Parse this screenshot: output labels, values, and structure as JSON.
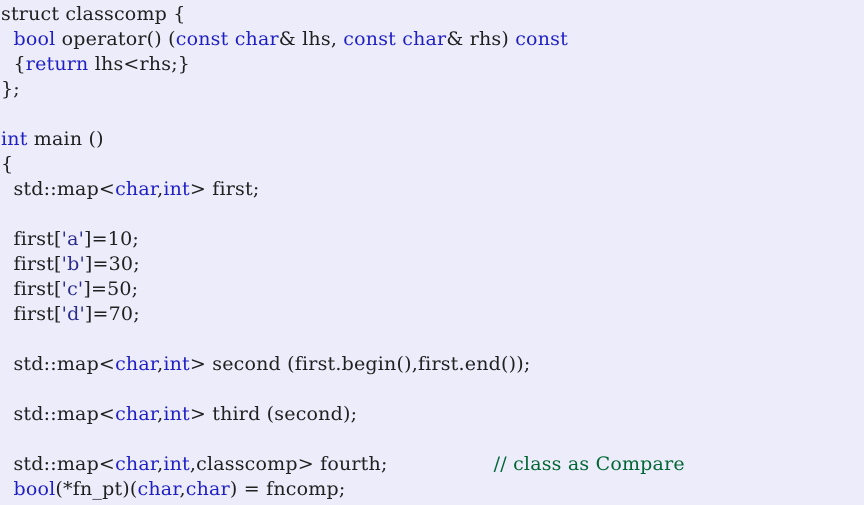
{
  "editor": {
    "background_color": "#ececfb",
    "default_text_color": "#202020",
    "keyword_color": "#1f1fc4",
    "comment_color": "#006633",
    "literal_color": "#2b2b8f",
    "language": "C++"
  },
  "code": {
    "lines": [
      {
        "index": 1,
        "text": "struct classcomp {",
        "tokens": [
          {
            "t": "struct classcomp {",
            "c": "plain"
          }
        ]
      },
      {
        "index": 2,
        "text": "  bool operator() (const char& lhs, const char& rhs) const",
        "tokens": [
          {
            "t": "  ",
            "c": "plain"
          },
          {
            "t": "bool",
            "c": "kw"
          },
          {
            "t": " operator() (",
            "c": "plain"
          },
          {
            "t": "const",
            "c": "kw"
          },
          {
            "t": " ",
            "c": "plain"
          },
          {
            "t": "char",
            "c": "kw"
          },
          {
            "t": "& lhs, ",
            "c": "plain"
          },
          {
            "t": "const",
            "c": "kw"
          },
          {
            "t": " ",
            "c": "plain"
          },
          {
            "t": "char",
            "c": "kw"
          },
          {
            "t": "& rhs) ",
            "c": "plain"
          },
          {
            "t": "const",
            "c": "kw"
          }
        ]
      },
      {
        "index": 3,
        "text": "  {return lhs<rhs;}",
        "tokens": [
          {
            "t": "  {",
            "c": "plain"
          },
          {
            "t": "return",
            "c": "kw"
          },
          {
            "t": " lhs<rhs;}",
            "c": "plain"
          }
        ]
      },
      {
        "index": 4,
        "text": "};",
        "tokens": [
          {
            "t": "};",
            "c": "plain"
          }
        ]
      },
      {
        "index": 5,
        "text": "",
        "tokens": []
      },
      {
        "index": 6,
        "text": "int main ()",
        "tokens": [
          {
            "t": "int",
            "c": "kw"
          },
          {
            "t": " main ()",
            "c": "plain"
          }
        ]
      },
      {
        "index": 7,
        "text": "{",
        "tokens": [
          {
            "t": "{",
            "c": "plain"
          }
        ]
      },
      {
        "index": 8,
        "text": "  std::map<char,int> first;",
        "tokens": [
          {
            "t": "  std::map<",
            "c": "plain"
          },
          {
            "t": "char",
            "c": "kw"
          },
          {
            "t": ",",
            "c": "plain"
          },
          {
            "t": "int",
            "c": "kw"
          },
          {
            "t": "> first;",
            "c": "plain"
          }
        ]
      },
      {
        "index": 9,
        "text": "",
        "tokens": []
      },
      {
        "index": 10,
        "text": "  first['a']=10;",
        "tokens": [
          {
            "t": "  first[",
            "c": "plain"
          },
          {
            "t": "'a'",
            "c": "lit"
          },
          {
            "t": "]=10;",
            "c": "plain"
          }
        ]
      },
      {
        "index": 11,
        "text": "  first['b']=30;",
        "tokens": [
          {
            "t": "  first[",
            "c": "plain"
          },
          {
            "t": "'b'",
            "c": "lit"
          },
          {
            "t": "]=30;",
            "c": "plain"
          }
        ]
      },
      {
        "index": 12,
        "text": "  first['c']=50;",
        "tokens": [
          {
            "t": "  first[",
            "c": "plain"
          },
          {
            "t": "'c'",
            "c": "lit"
          },
          {
            "t": "]=50;",
            "c": "plain"
          }
        ]
      },
      {
        "index": 13,
        "text": "  first['d']=70;",
        "tokens": [
          {
            "t": "  first[",
            "c": "plain"
          },
          {
            "t": "'d'",
            "c": "lit"
          },
          {
            "t": "]=70;",
            "c": "plain"
          }
        ]
      },
      {
        "index": 14,
        "text": "",
        "tokens": []
      },
      {
        "index": 15,
        "text": "  std::map<char,int> second (first.begin(),first.end());",
        "tokens": [
          {
            "t": "  std::map<",
            "c": "plain"
          },
          {
            "t": "char",
            "c": "kw"
          },
          {
            "t": ",",
            "c": "plain"
          },
          {
            "t": "int",
            "c": "kw"
          },
          {
            "t": "> second (first.begin(),first.end());",
            "c": "plain"
          }
        ]
      },
      {
        "index": 16,
        "text": "",
        "tokens": []
      },
      {
        "index": 17,
        "text": "  std::map<char,int> third (second);",
        "tokens": [
          {
            "t": "  std::map<",
            "c": "plain"
          },
          {
            "t": "char",
            "c": "kw"
          },
          {
            "t": ",",
            "c": "plain"
          },
          {
            "t": "int",
            "c": "kw"
          },
          {
            "t": "> third (second);",
            "c": "plain"
          }
        ]
      },
      {
        "index": 18,
        "text": "",
        "tokens": []
      },
      {
        "index": 19,
        "text": "  std::map<char,int,classcomp> fourth;                 // class as Compare",
        "tokens": [
          {
            "t": "  std::map<",
            "c": "plain"
          },
          {
            "t": "char",
            "c": "kw"
          },
          {
            "t": ",",
            "c": "plain"
          },
          {
            "t": "int",
            "c": "kw"
          },
          {
            "t": ",classcomp> fourth;",
            "c": "plain"
          },
          {
            "t": "                 ",
            "c": "plain"
          },
          {
            "t": "// class as Compare",
            "c": "cmt"
          }
        ]
      },
      {
        "index": 20,
        "text": "  bool(*fn_pt)(char,char) = fncomp;",
        "tokens": [
          {
            "t": "  ",
            "c": "plain"
          },
          {
            "t": "bool",
            "c": "kw"
          },
          {
            "t": "(*fn_pt)(",
            "c": "plain"
          },
          {
            "t": "char",
            "c": "kw"
          },
          {
            "t": ",",
            "c": "plain"
          },
          {
            "t": "char",
            "c": "kw"
          },
          {
            "t": ") = fncomp;",
            "c": "plain"
          }
        ]
      }
    ]
  }
}
